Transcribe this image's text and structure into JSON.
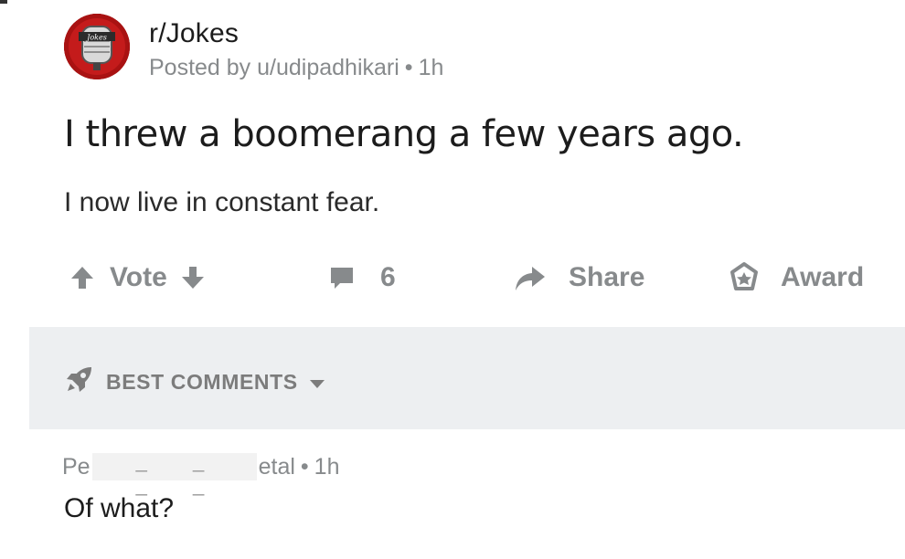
{
  "post": {
    "subreddit": "r/Jokes",
    "posted_by": "Posted by u/udipadhikari",
    "separator": "•",
    "age": "1h",
    "title": "I threw a boomerang a few years ago.",
    "body": "I now live in constant fear."
  },
  "actions": {
    "vote_label": "Vote",
    "comment_count": "6",
    "share_label": "Share",
    "award_label": "Award"
  },
  "comments_header": {
    "sort_label": "BEST COMMENTS"
  },
  "comment": {
    "author_prefix": "Pe",
    "author_suffix": "etal",
    "separator": "•",
    "age": "1h",
    "text": "Of what?"
  },
  "icons": {
    "avatar": "jokes-microphone-logo",
    "upvote": "arrow-up-icon",
    "downvote": "arrow-down-icon",
    "comments": "speech-bubble-icon",
    "share": "share-arrow-icon",
    "award": "award-badge-icon",
    "sort": "rocket-icon",
    "sort_dropdown": "caret-down-icon"
  },
  "colors": {
    "text": "#1c1c1c",
    "muted": "#878a8c",
    "band": "#edeff1",
    "avatar_red": "#b31515"
  }
}
